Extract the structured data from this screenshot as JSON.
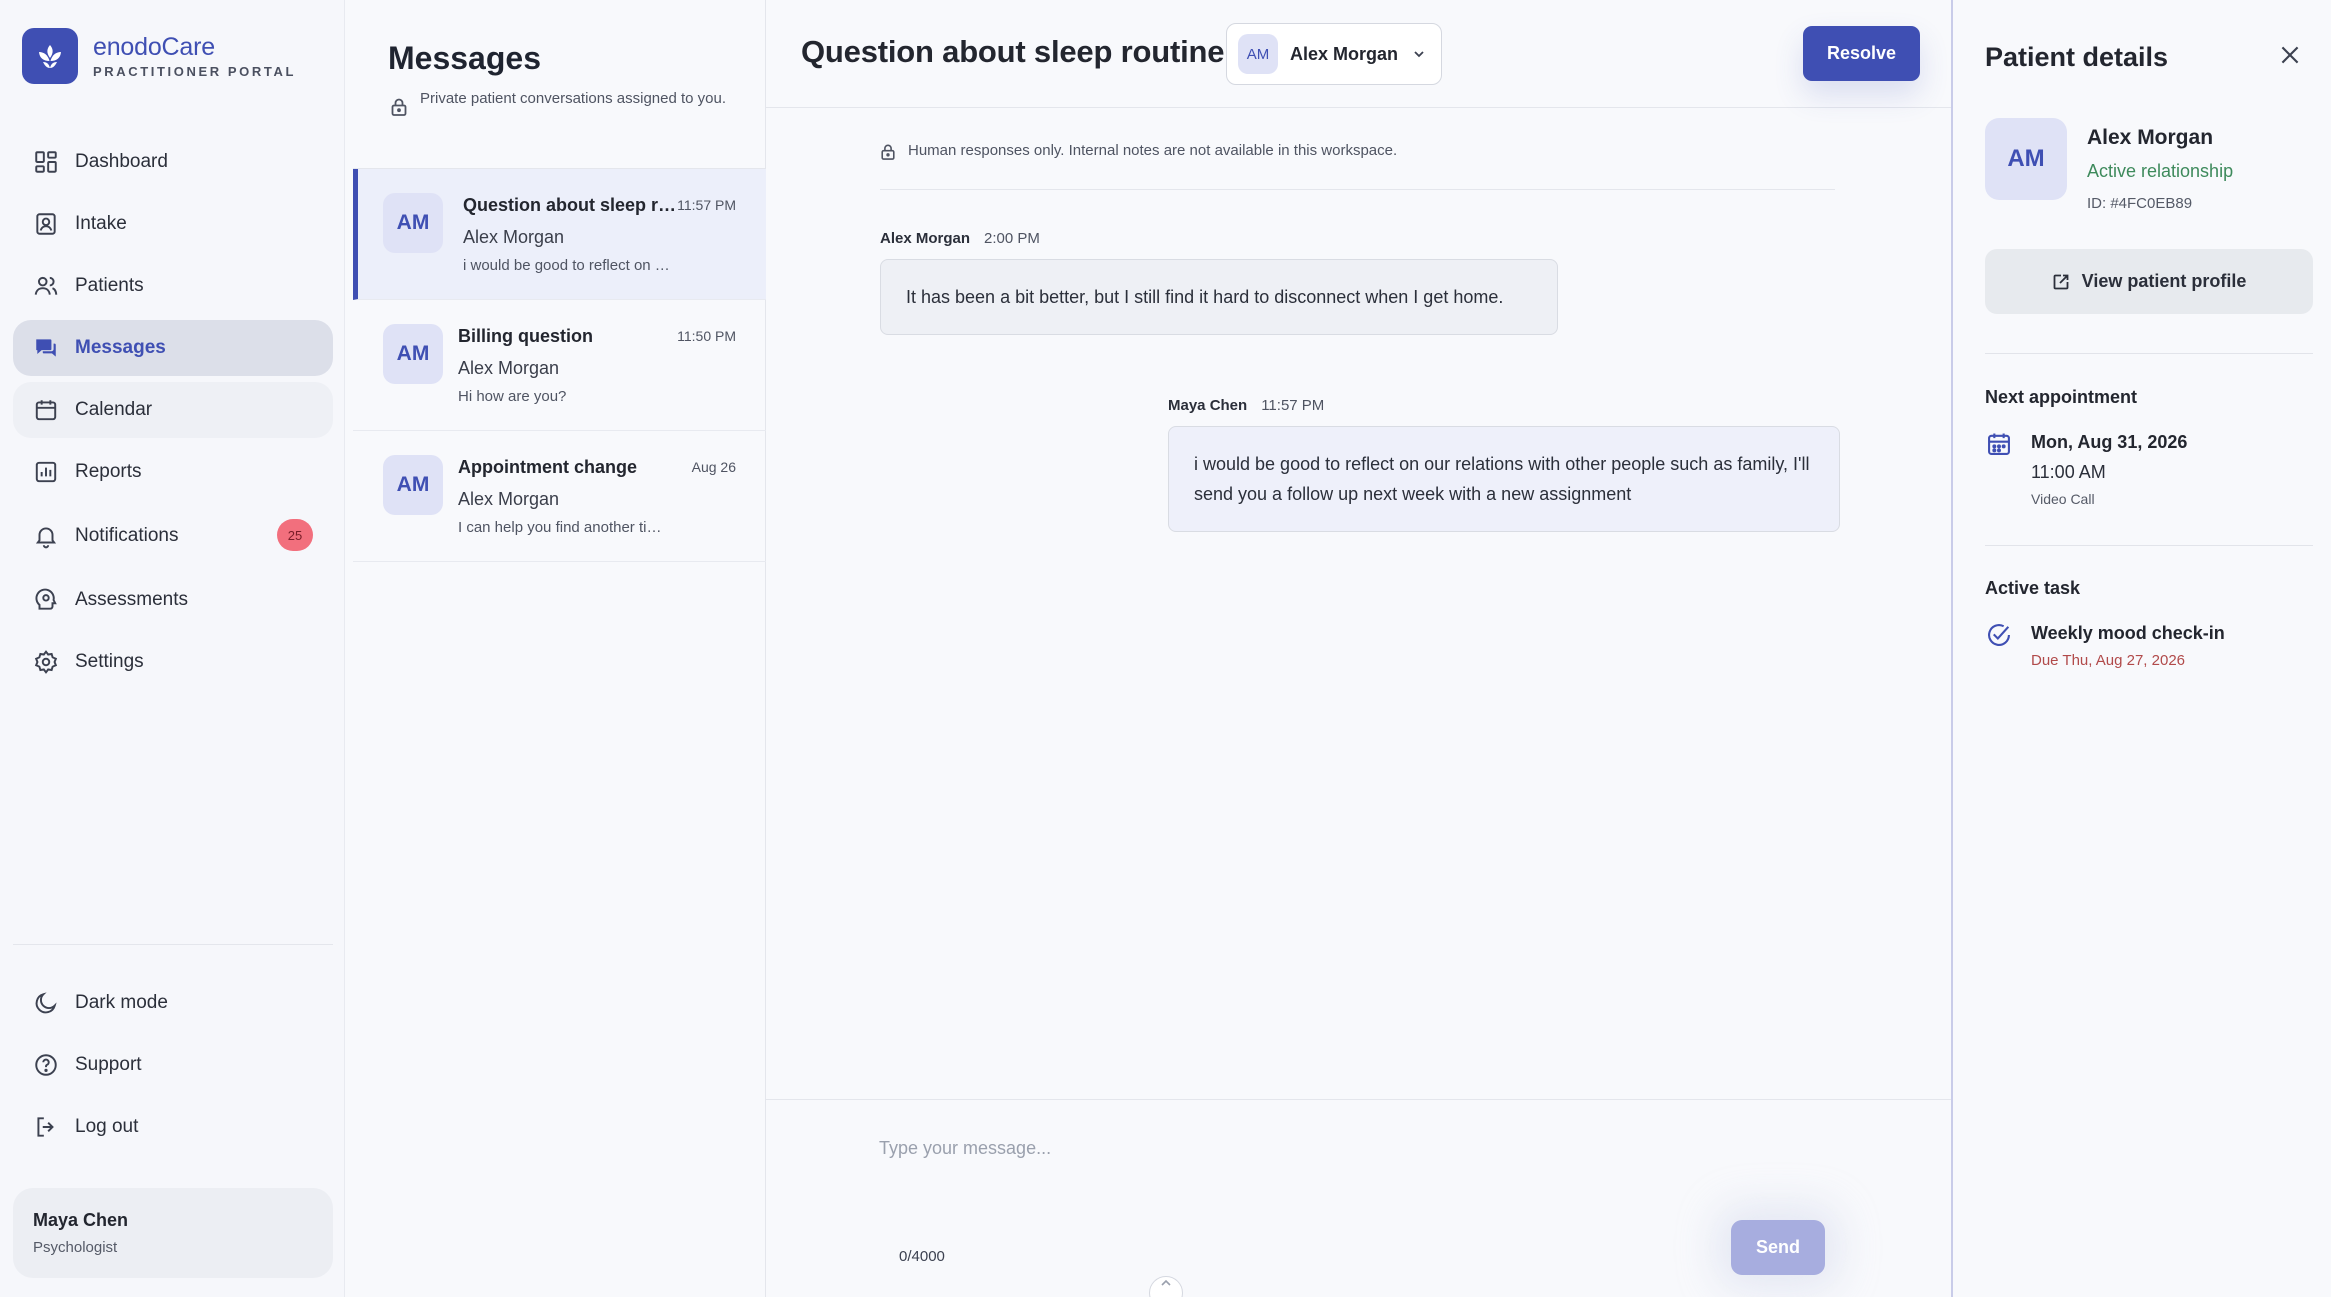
{
  "brand": {
    "name": "enodoCare",
    "subtitle": "PRACTITIONER PORTAL",
    "accent": "#3f4fb3"
  },
  "sidebar": {
    "items": [
      {
        "label": "Dashboard",
        "icon": "dashboard-icon"
      },
      {
        "label": "Intake",
        "icon": "intake-icon"
      },
      {
        "label": "Patients",
        "icon": "patients-icon"
      },
      {
        "label": "Messages",
        "icon": "messages-icon",
        "active": true
      },
      {
        "label": "Calendar",
        "icon": "calendar-icon"
      },
      {
        "label": "Reports",
        "icon": "reports-icon"
      },
      {
        "label": "Notifications",
        "icon": "bell-icon",
        "badge": "25"
      },
      {
        "label": "Assessments",
        "icon": "assessments-icon"
      },
      {
        "label": "Settings",
        "icon": "gear-icon"
      }
    ],
    "bottom": [
      {
        "label": "Dark mode",
        "icon": "moon-icon"
      },
      {
        "label": "Support",
        "icon": "help-icon"
      },
      {
        "label": "Log out",
        "icon": "logout-icon"
      }
    ],
    "user": {
      "name": "Maya Chen",
      "role": "Psychologist"
    }
  },
  "conversations": {
    "title": "Messages",
    "note": "Private patient conversations assigned to you.",
    "items": [
      {
        "avatar": "AM",
        "title": "Question about sleep routine",
        "name": "Alex Morgan",
        "preview": "i would be good to reflect on our relations with other people such as family",
        "time": "11:57 PM",
        "selected": true
      },
      {
        "avatar": "AM",
        "title": "Billing question",
        "name": "Alex Morgan",
        "preview": "Hi how are you?",
        "time": "11:50 PM"
      },
      {
        "avatar": "AM",
        "title": "Appointment change",
        "name": "Alex Morgan",
        "preview": "I can help you find another time that works",
        "time": "Aug 26"
      }
    ]
  },
  "chat": {
    "title": "Question about sleep routine",
    "patient": {
      "avatar": "AM",
      "name": "Alex Morgan"
    },
    "resolve_label": "Resolve",
    "notice": "Human responses only. Internal notes are not available in this workspace.",
    "messages": [
      {
        "sender": "Alex Morgan",
        "time": "2:00 PM",
        "text": "It has been a bit better, but I still find it hard to disconnect when I get home."
      },
      {
        "sender": "Maya Chen",
        "time": "11:57 PM",
        "text": "i would be good to reflect on our relations with other people such as family, I'll send you a follow up next week with a new assignment"
      }
    ],
    "composer": {
      "placeholder": "Type your message...",
      "count": "0/4000",
      "send_label": "Send"
    }
  },
  "details": {
    "title": "Patient details",
    "avatar": "AM",
    "name": "Alex Morgan",
    "status": "Active relationship",
    "id": "ID: #4FC0EB89",
    "view_label": "View patient profile",
    "next_label": "Next appointment",
    "appt_date": "Mon, Aug 31, 2026",
    "appt_time": "11:00 AM",
    "appt_type": "Video Call",
    "task_label": "Active task",
    "task_name": "Weekly mood check-in",
    "task_due": "Due Thu, Aug 27, 2026"
  }
}
